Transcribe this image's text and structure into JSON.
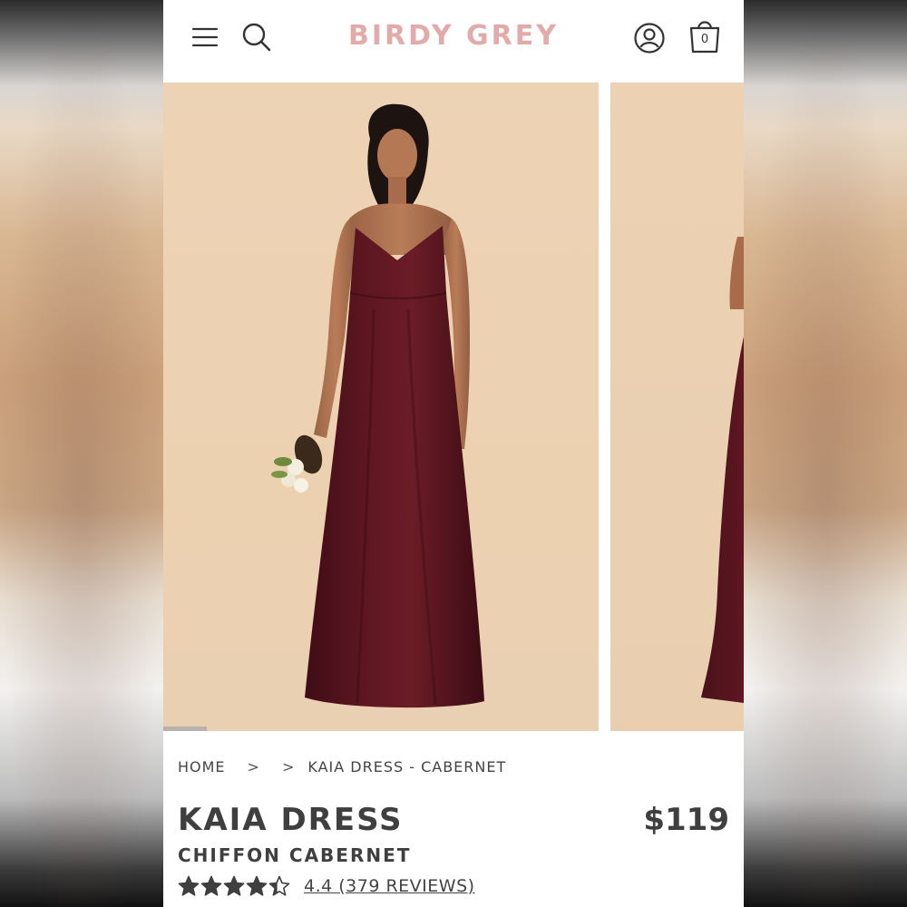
{
  "brand": {
    "logo_text": "BIRDY GREY",
    "logo_color": "#e2aaa8"
  },
  "header": {
    "menu_icon": "hamburger-menu-icon",
    "search_icon": "search-icon",
    "account_icon": "account-icon",
    "cart_icon": "shopping-bag-icon",
    "cart_count": "0"
  },
  "gallery": {
    "slides": [
      "dress-front-image",
      "dress-side-image"
    ],
    "dress_color": "#5a1620",
    "background_color": "#ecd2b3",
    "progress": 0.1
  },
  "breadcrumb": {
    "home": "HOME",
    "separator": ">",
    "current": "KAIA DRESS - CABERNET"
  },
  "product": {
    "name": "KAIA DRESS",
    "subtitle": "CHIFFON CABERNET",
    "price": "$119",
    "rating_value": 4.4,
    "rating_text": "4.4 (379 REVIEWS)",
    "text_color": "#3f3f3f"
  }
}
